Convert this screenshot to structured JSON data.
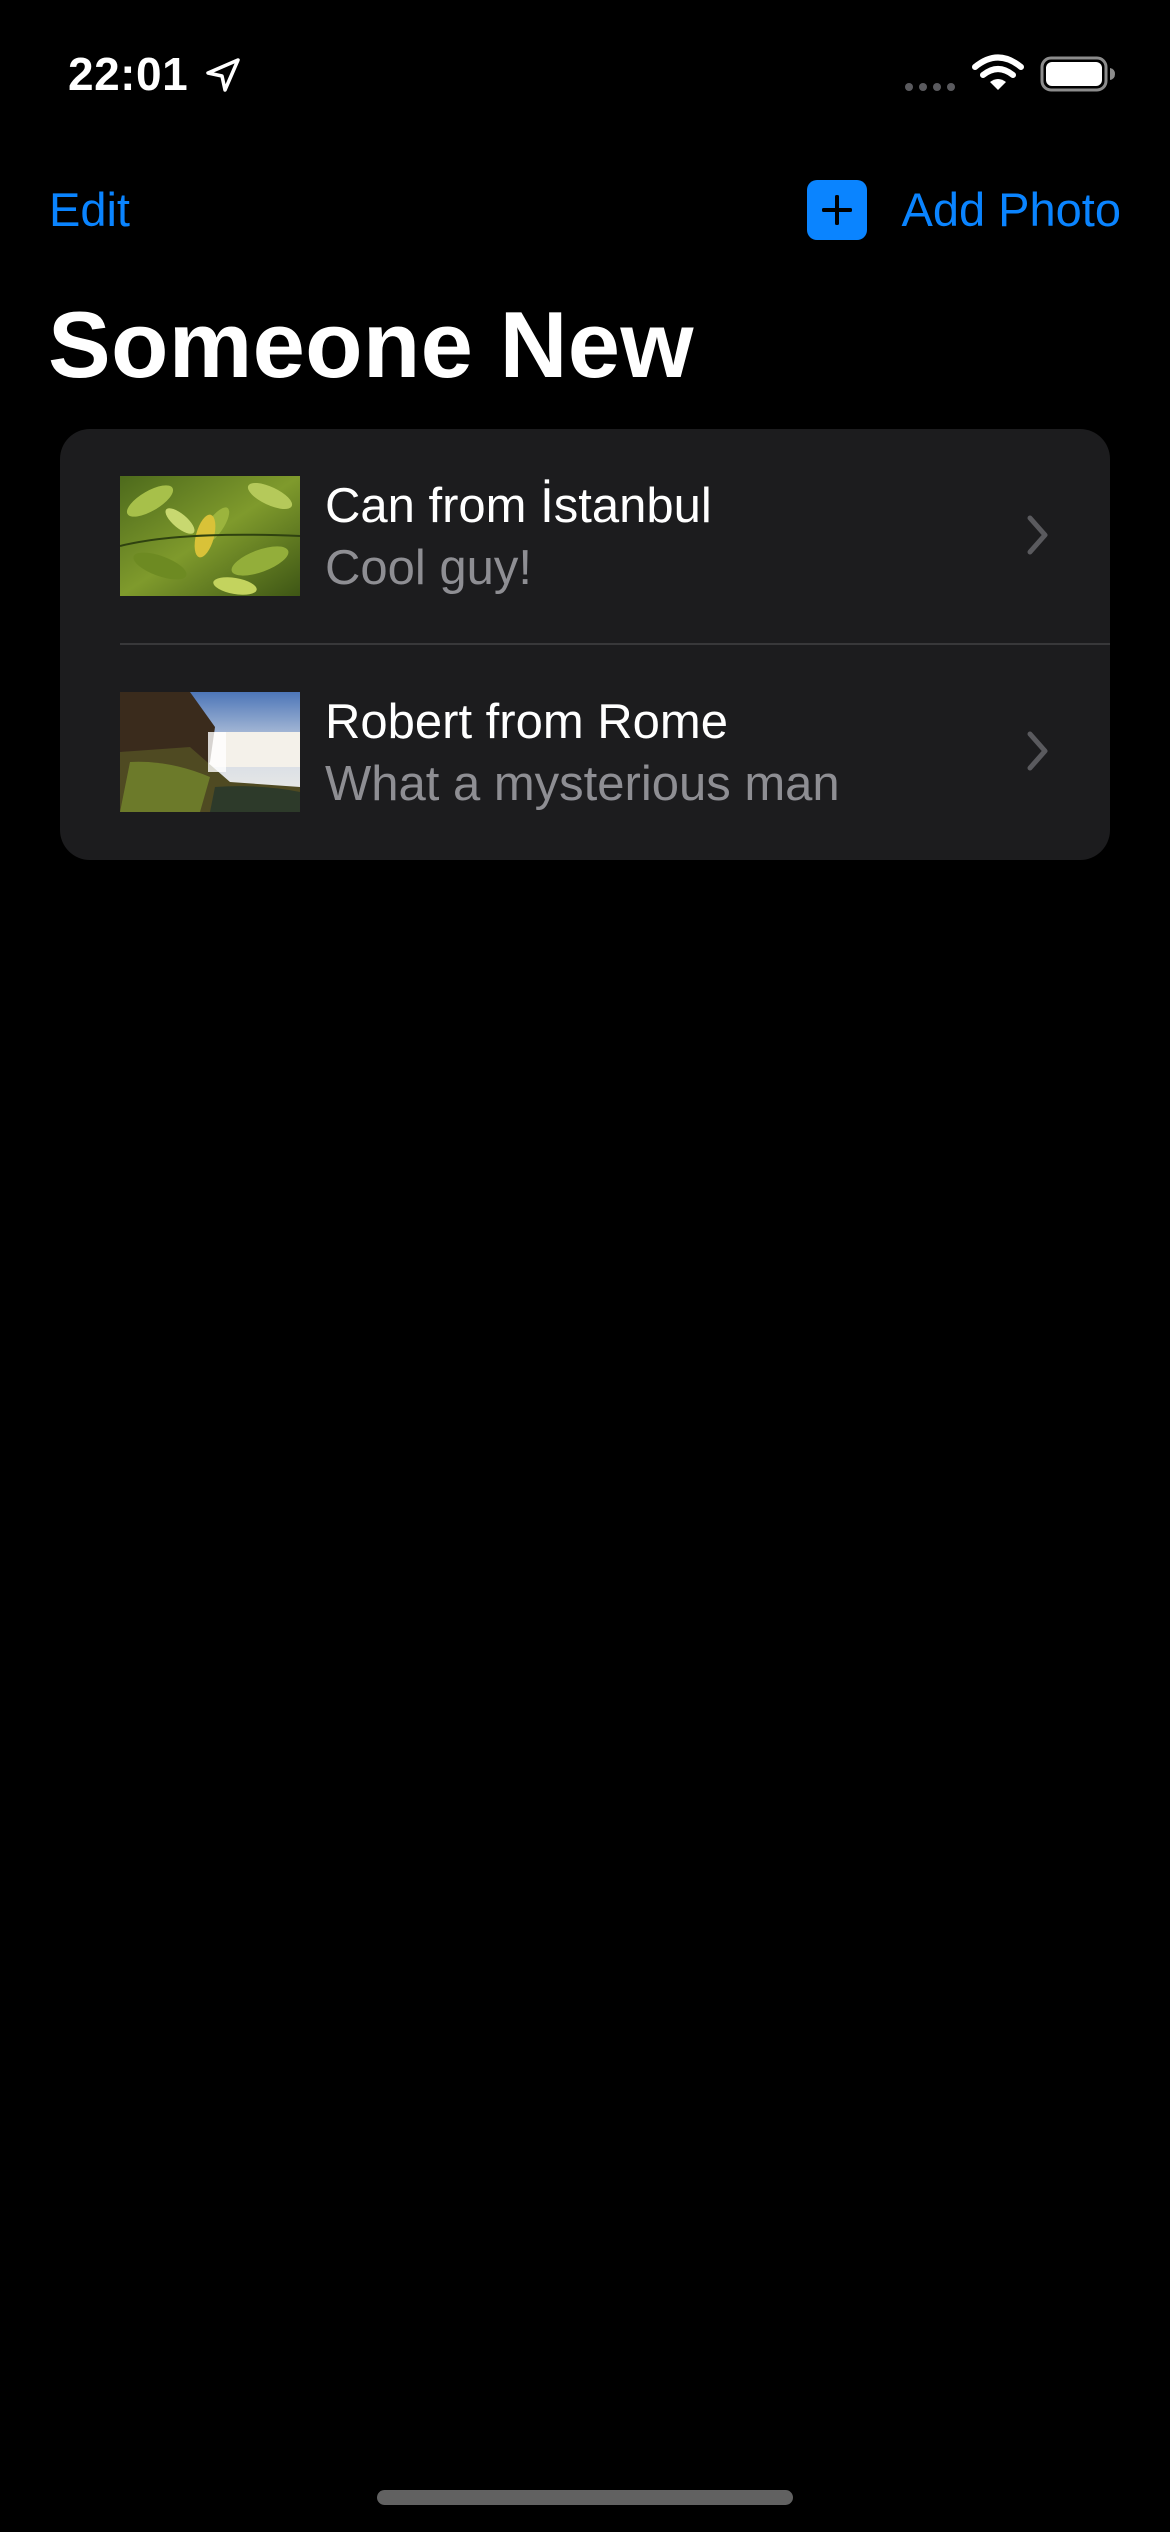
{
  "status_bar": {
    "time": "22:01",
    "icons": [
      "location-arrow-icon",
      "cellular-signal-icon",
      "wifi-icon",
      "battery-icon"
    ]
  },
  "nav": {
    "edit_label": "Edit",
    "add_label": "Add Photo",
    "add_icon": "plus-square-icon"
  },
  "page": {
    "title": "Someone New"
  },
  "list": {
    "items": [
      {
        "title": "Can from İstanbul",
        "subtitle": "Cool guy!",
        "thumbnail": "leaves-photo-thumbnail"
      },
      {
        "title": "Robert from Rome",
        "subtitle": "What a mysterious man",
        "thumbnail": "waterfall-photo-thumbnail"
      }
    ]
  },
  "colors": {
    "background": "#000000",
    "card": "#1c1c1e",
    "accent": "#0a84ff",
    "secondary_text": "#8e8e93",
    "separator": "#38383a"
  }
}
